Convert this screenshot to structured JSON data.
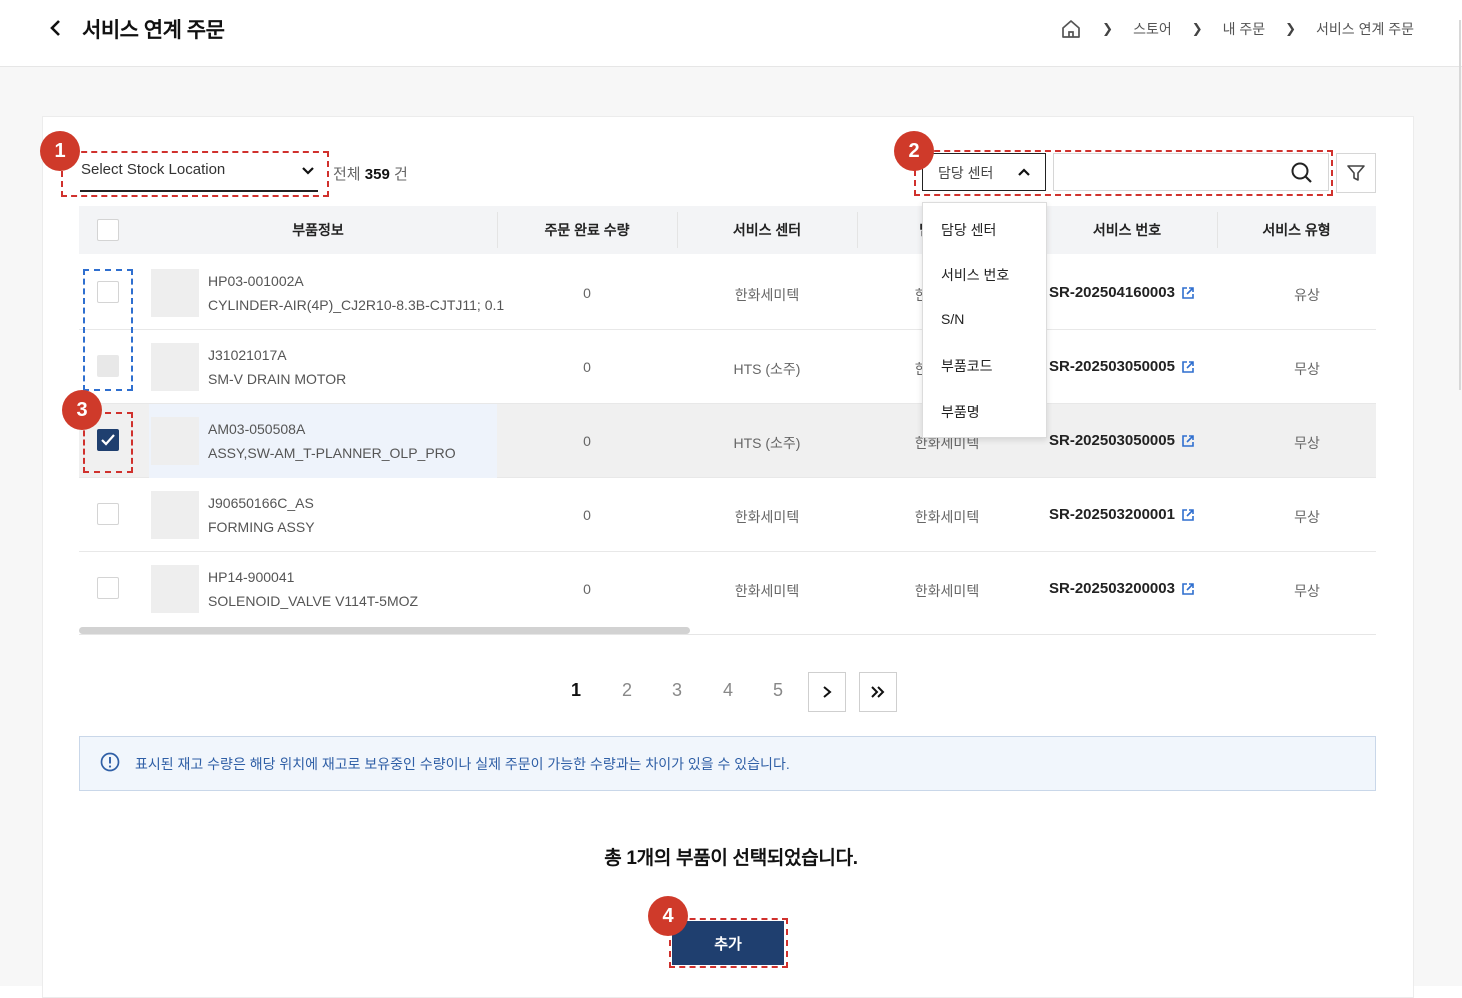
{
  "header": {
    "title": "서비스 연계 주문",
    "breadcrumbs": [
      "스토어",
      "내 주문",
      "서비스 연계 주문"
    ]
  },
  "toolbar": {
    "stock_location_placeholder": "Select Stock Location",
    "total_prefix": "전체",
    "total_count": "359",
    "total_suffix": "건",
    "search_field_selected": "담당 센터",
    "search_value": "",
    "search_options": [
      "담당 센터",
      "서비스 번호",
      "S/N",
      "부품코드",
      "부품명"
    ]
  },
  "table": {
    "columns": [
      "부품정보",
      "주문 완료 수량",
      "서비스 센터",
      "담당 센터",
      "서비스 번호",
      "서비스 유형"
    ],
    "rows": [
      {
        "code": "HP03-001002A",
        "name": "CYLINDER-AIR(4P)_CJ2R10-8.3B-CJTJ11; 0.1",
        "qty": "0",
        "service_center": "한화세미텍",
        "assigned_center": "한화세미텍",
        "service_no": "SR-202504160003",
        "type": "유상",
        "checked": false,
        "disabled": false
      },
      {
        "code": "J31021017A",
        "name": "SM-V DRAIN MOTOR",
        "qty": "0",
        "service_center": "HTS (소주)",
        "assigned_center": "한화세미텍",
        "service_no": "SR-202503050005",
        "type": "무상",
        "checked": false,
        "disabled": true
      },
      {
        "code": "AM03-050508A",
        "name": "ASSY,SW-AM_T-PLANNER_OLP_PRO",
        "qty": "0",
        "service_center": "HTS (소주)",
        "assigned_center": "한화세미텍",
        "service_no": "SR-202503050005",
        "type": "무상",
        "checked": true,
        "disabled": false
      },
      {
        "code": "J90650166C_AS",
        "name": "FORMING ASSY",
        "qty": "0",
        "service_center": "한화세미텍",
        "assigned_center": "한화세미텍",
        "service_no": "SR-202503200001",
        "type": "무상",
        "checked": false,
        "disabled": false
      },
      {
        "code": "HP14-900041",
        "name": "SOLENOID_VALVE V114T-5MOZ",
        "qty": "0",
        "service_center": "한화세미텍",
        "assigned_center": "한화세미텍",
        "service_no": "SR-202503200003",
        "type": "무상",
        "checked": false,
        "disabled": false
      }
    ]
  },
  "pagination": {
    "pages": [
      "1",
      "2",
      "3",
      "4",
      "5"
    ],
    "current": "1"
  },
  "notice": "표시된 재고 수량은 해당 위치에 재고로 보유중인 수량이나 실제 주문이 가능한 수량과는 차이가 있을 수 있습니다.",
  "selection_summary": "총 1개의 부품이 선택되었습니다.",
  "add_button_label": "추가",
  "annotations": [
    "1",
    "2",
    "3",
    "4"
  ],
  "colors": {
    "accent": "#1f3f6f",
    "annotation": "#cf3a2a",
    "notice_text": "#2f5fa6"
  }
}
